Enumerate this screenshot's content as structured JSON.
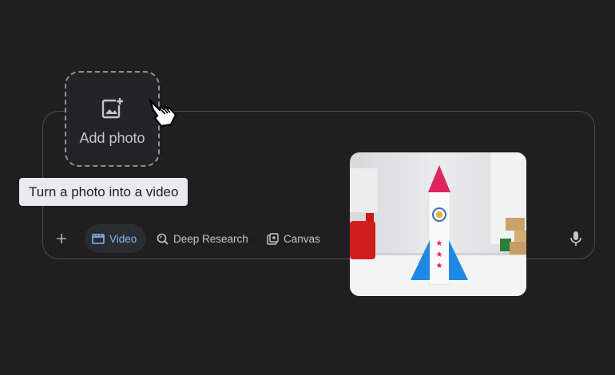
{
  "add_photo": {
    "label": "Add photo",
    "icon": "add-photo-icon"
  },
  "tooltip": {
    "text": "Turn a photo into a video"
  },
  "toolbar": {
    "plus_icon": "plus-icon",
    "video_label": "Video",
    "deep_research_label": "Deep Research",
    "canvas_label": "Canvas",
    "mic_icon": "mic-icon"
  },
  "colors": {
    "accent": "#8ab4f8",
    "background": "#1f1f20",
    "tooltip_bg": "#e8eaed"
  },
  "preview_image": {
    "subject": "paper rocket toy"
  }
}
